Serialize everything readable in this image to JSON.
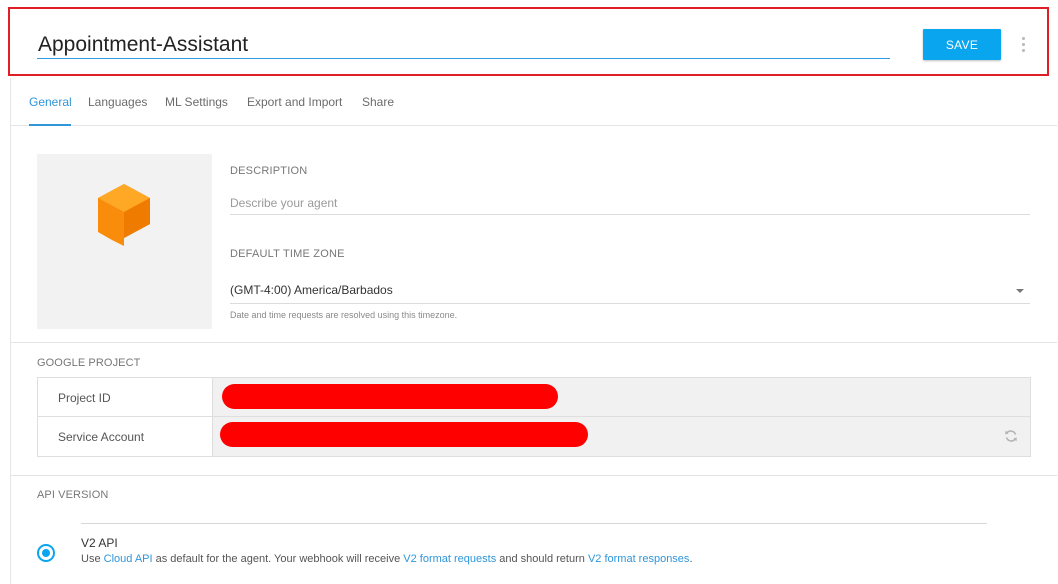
{
  "header": {
    "agent_name": "Appointment-Assistant",
    "save_label": "SAVE"
  },
  "tabs": [
    {
      "label": "General",
      "active": true
    },
    {
      "label": "Languages",
      "active": false
    },
    {
      "label": "ML Settings",
      "active": false
    },
    {
      "label": "Export and Import",
      "active": false
    },
    {
      "label": "Share",
      "active": false
    }
  ],
  "general": {
    "description_label": "DESCRIPTION",
    "description_placeholder": "Describe your agent",
    "description_value": "",
    "timezone_label": "DEFAULT TIME ZONE",
    "timezone_value": "(GMT-4:00) America/Barbados",
    "timezone_hint": "Date and time requests are resolved using this timezone."
  },
  "google_project": {
    "title": "GOOGLE PROJECT",
    "rows": [
      {
        "key": "Project ID",
        "value_redacted": true
      },
      {
        "key": "Service Account",
        "value_redacted": true
      }
    ]
  },
  "api_version": {
    "title": "API VERSION",
    "option_title": "V2 API",
    "selected": true,
    "desc_1": "Use ",
    "link_cloud_api": "Cloud API",
    "desc_2": " as default for the agent. Your webhook will receive ",
    "link_v2_requests": "V2 format requests",
    "desc_3": " and should return ",
    "link_v2_responses": "V2 format responses",
    "desc_4": "."
  },
  "colors": {
    "accent": "#0aa5ef",
    "link": "#2f96d9",
    "highlight_border": "#e01e25",
    "redaction": "#ff0000",
    "logo_orange": "#f98c0a",
    "logo_orange_light": "#ffa826"
  },
  "icons": {
    "logo": "dialogflow-logo-icon",
    "menu": "kebab-menu-icon",
    "refresh": "refresh-icon",
    "dropdown": "chevron-down-icon"
  }
}
